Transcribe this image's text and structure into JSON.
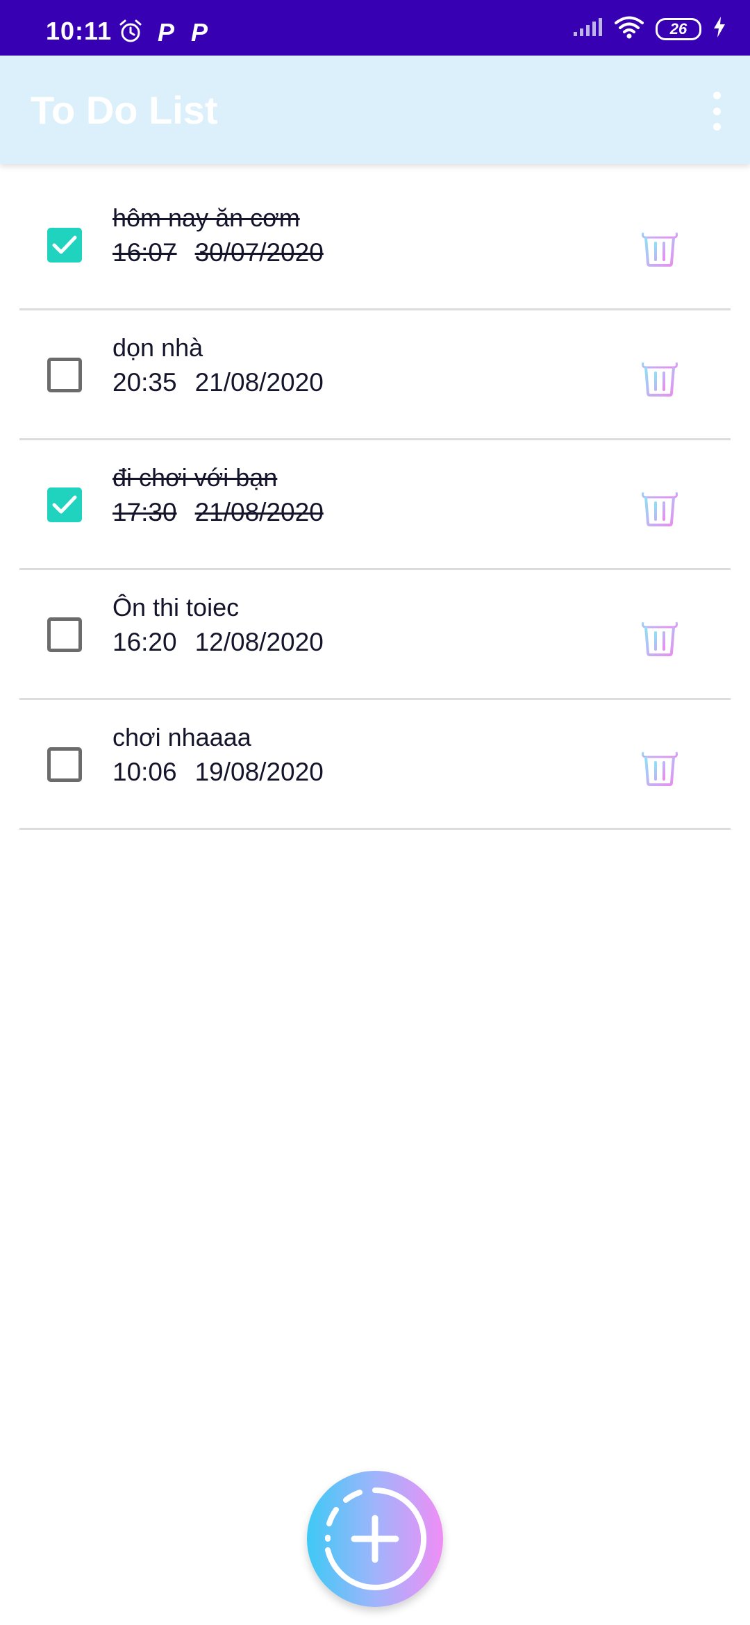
{
  "status_bar": {
    "time": "10:11",
    "left_icons": [
      "alarm-icon",
      "p-icon",
      "p-icon"
    ],
    "p_letter": "P",
    "battery_level": "26",
    "right_icons": [
      "signal-icon",
      "wifi-icon",
      "battery-icon",
      "charging-icon"
    ]
  },
  "app_bar": {
    "title": "To Do List",
    "menu_icon": "more-vert-icon"
  },
  "todos": [
    {
      "title": "hôm nay ăn cơm",
      "time": "16:07",
      "date": "30/07/2020",
      "done": true
    },
    {
      "title": "dọn nhà",
      "time": "20:35",
      "date": "21/08/2020",
      "done": false
    },
    {
      "title": "đi chơi với bạn",
      "time": "17:30",
      "date": "21/08/2020",
      "done": true
    },
    {
      "title": "Ôn thi toiec",
      "time": "16:20",
      "date": "12/08/2020",
      "done": false
    },
    {
      "title": "chơi nhaaaa",
      "time": "10:06",
      "date": "19/08/2020",
      "done": false
    }
  ],
  "fab": {
    "icon": "add-icon"
  },
  "colors": {
    "status_bar": "#3700b3",
    "app_bar": "#dcf0fb",
    "checkbox_checked": "#1fd3bf",
    "checkbox_unchecked": "#6b6b6b",
    "gradient_start": "#3ec9f5",
    "gradient_end": "#ef8ef5"
  }
}
